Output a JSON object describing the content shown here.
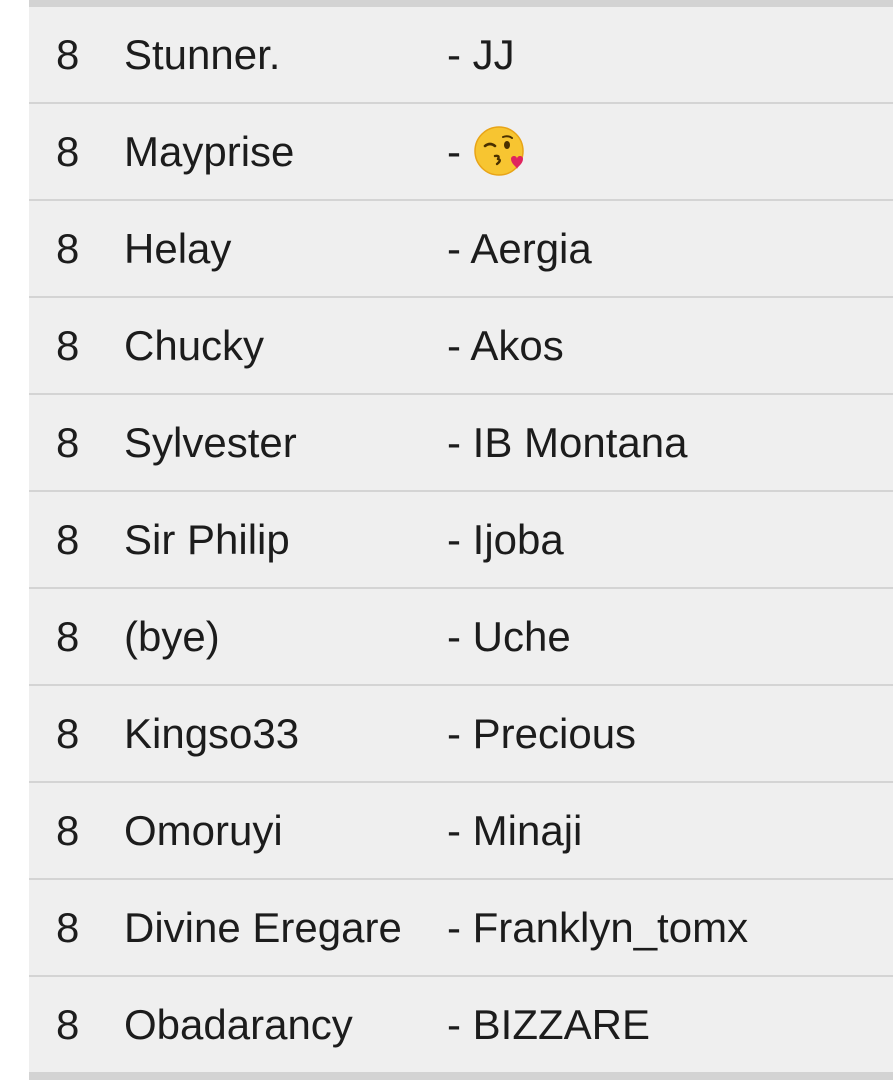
{
  "rows": [
    {
      "rank": "8",
      "player": "Stunner.",
      "partner": "- JJ"
    },
    {
      "rank": "8",
      "player": "Mayprise",
      "partner": "- ",
      "partner_icon": "kissing-face-with-heart-emoji"
    },
    {
      "rank": "8",
      "player": "Helay",
      "partner": "- Aergia"
    },
    {
      "rank": "8",
      "player": "Chucky",
      "partner": "- Akos"
    },
    {
      "rank": "8",
      "player": "Sylvester",
      "partner": "- IB Montana"
    },
    {
      "rank": "8",
      "player": "Sir Philip",
      "partner": "- Ijoba"
    },
    {
      "rank": "8",
      "player": "(bye)",
      "partner": "- Uche"
    },
    {
      "rank": "8",
      "player": "Kingso33",
      "partner": "- Precious"
    },
    {
      "rank": "8",
      "player": "Omoruyi",
      "partner": "- Minaji"
    },
    {
      "rank": "8",
      "player": "Divine Eregare",
      "partner": "- Franklyn_tomx"
    },
    {
      "rank": "8",
      "player": "Obadarancy",
      "partner": "- BIZZARE"
    }
  ],
  "colors": {
    "row_background": "#efefef",
    "divider": "#d4d4d4",
    "text": "#1c1c1c"
  }
}
